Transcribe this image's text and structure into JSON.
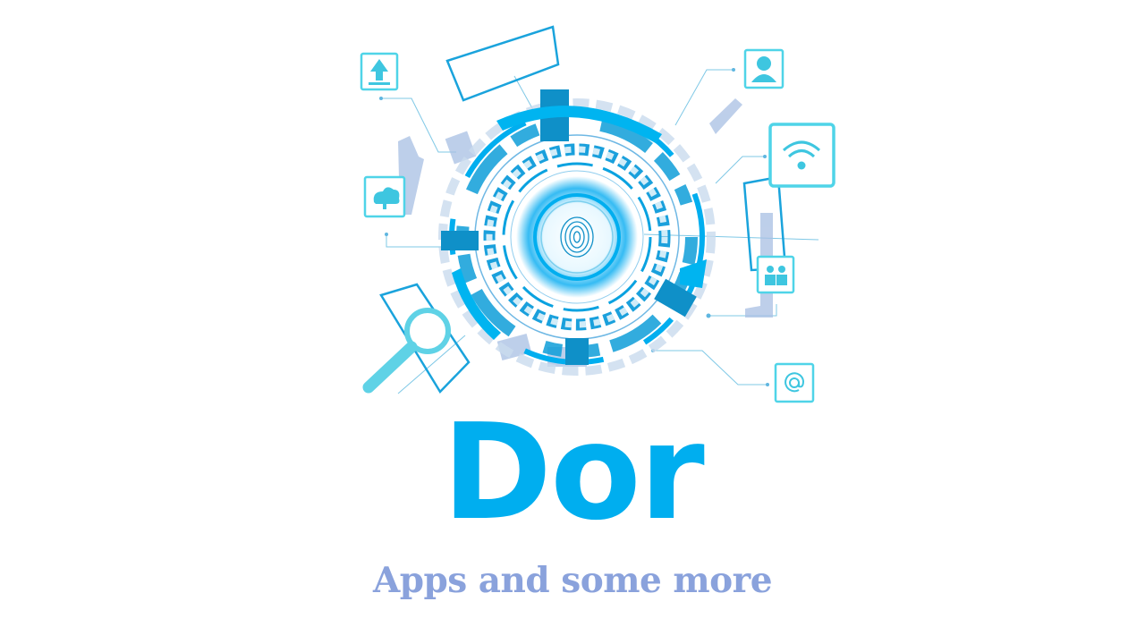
{
  "brand": {
    "title": "Dor",
    "tagline": "Apps and some more"
  },
  "hero": {
    "icons": [
      "upload-icon",
      "user-icon",
      "wifi-icon",
      "cloud-icon",
      "users-icon",
      "at-sign-icon",
      "magnifier-icon",
      "fingerprint-icon"
    ]
  },
  "colors": {
    "brand_blue": "#00aeef",
    "tagline": "#8aa2dc",
    "accent_cyan": "#4fd4e8",
    "accent_light": "#aac4e6"
  }
}
